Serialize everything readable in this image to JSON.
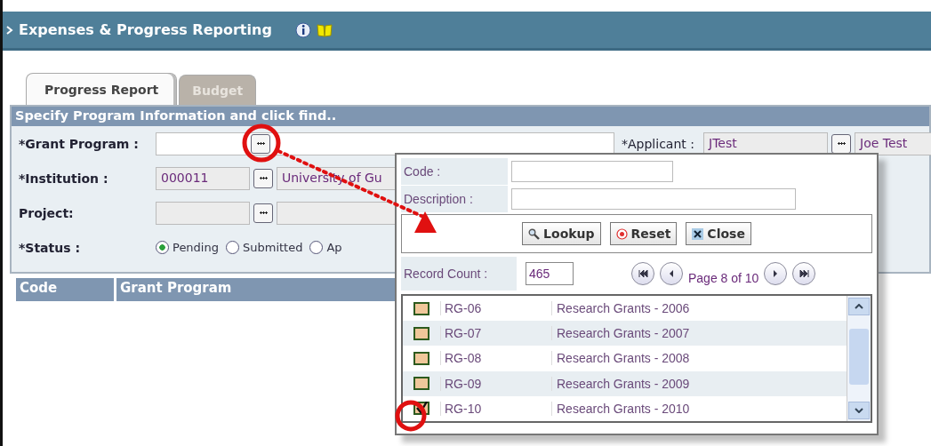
{
  "header": {
    "title": "Expenses & Progress Reporting"
  },
  "tabs": [
    {
      "label": "Progress Report",
      "selected": true
    },
    {
      "label": "Budget",
      "selected": false
    }
  ],
  "panel": {
    "title": "Specify Program Information and click find..",
    "rows": [
      {
        "label": "*Grant Program :",
        "kind": "single"
      },
      {
        "label": "*Institution :",
        "code": "000011",
        "name": "University of Gu",
        "kind": "pair"
      },
      {
        "label": "Project:",
        "kind": "pair"
      }
    ],
    "status": {
      "label": "*Status :",
      "options": [
        {
          "label": "Pending",
          "selected": true
        },
        {
          "label": "Submitted",
          "selected": false
        },
        {
          "label": "Ap",
          "selected": false
        }
      ]
    },
    "applicant": {
      "label": "*Applicant :",
      "code": "JTest",
      "name": "Joe Test"
    }
  },
  "table": {
    "columns": [
      "Code",
      "Grant Program"
    ]
  },
  "lookup": {
    "fields": [
      {
        "label": "Code :"
      },
      {
        "label": "Description :"
      }
    ],
    "buttons": [
      {
        "kind": "search",
        "label": "Lookup"
      },
      {
        "kind": "reset",
        "label": "Reset"
      },
      {
        "kind": "close",
        "label": "Close"
      }
    ],
    "record_count_label": "Record Count :",
    "record_count": "465",
    "page": "Page 8 of 10",
    "rows": [
      {
        "code": "RG-06",
        "name": "Research Grants - 2006",
        "checked": false
      },
      {
        "code": "RG-07",
        "name": "Research Grants - 2007",
        "checked": false
      },
      {
        "code": "RG-08",
        "name": "Research Grants - 2008",
        "checked": false
      },
      {
        "code": "RG-09",
        "name": "Research Grants - 2009",
        "checked": false
      },
      {
        "code": "RG-10",
        "name": "Research Grants - 2010",
        "checked": true
      }
    ]
  }
}
